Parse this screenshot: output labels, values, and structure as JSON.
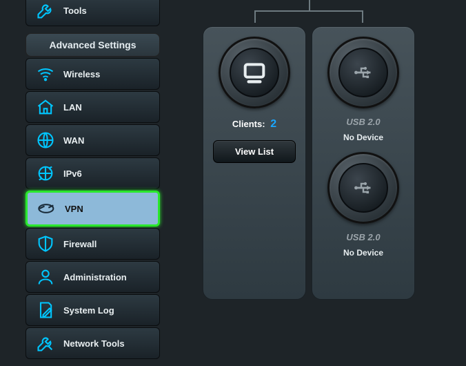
{
  "sidebar": {
    "tools_label": "Tools",
    "section_label": "Advanced Settings",
    "items": [
      {
        "label": "Wireless"
      },
      {
        "label": "LAN"
      },
      {
        "label": "WAN"
      },
      {
        "label": "IPv6"
      },
      {
        "label": "VPN"
      },
      {
        "label": "Firewall"
      },
      {
        "label": "Administration"
      },
      {
        "label": "System Log"
      },
      {
        "label": "Network Tools"
      }
    ]
  },
  "main": {
    "clients_label": "Clients:",
    "clients_count": "2",
    "view_list_label": "View List",
    "usb": [
      {
        "label": "USB 2.0",
        "status": "No Device"
      },
      {
        "label": "USB 2.0",
        "status": "No Device"
      }
    ]
  }
}
